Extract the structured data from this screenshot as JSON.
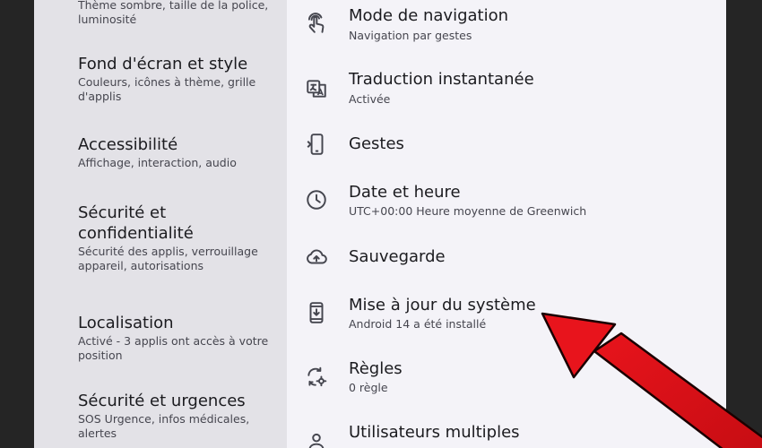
{
  "left_menu": [
    {
      "key": "display",
      "subtitle": "Thème sombre, taille de la police, luminosité"
    },
    {
      "key": "wallpaper",
      "title": "Fond d'écran et style",
      "subtitle": "Couleurs, icônes à thème, grille d'applis"
    },
    {
      "key": "accessibility",
      "title": "Accessibilité",
      "subtitle": "Affichage, interaction, audio"
    },
    {
      "key": "security",
      "title": "Sécurité et confidentialité",
      "subtitle": "Sécurité des applis, verrouillage appareil, autorisations"
    },
    {
      "key": "location",
      "title": "Localisation",
      "subtitle": "Activé - 3 applis ont accès à votre position"
    },
    {
      "key": "emergency",
      "title": "Sécurité et urgences",
      "subtitle": "SOS Urgence, infos médicales, alertes"
    }
  ],
  "system_menu": [
    {
      "key": "navigation-mode",
      "icon": "gesture-hand-icon",
      "title": "Mode de navigation",
      "subtitle": "Navigation par gestes"
    },
    {
      "key": "instant-translation",
      "icon": "translate-icon",
      "title": "Traduction instantanée",
      "subtitle": "Activée"
    },
    {
      "key": "gestures",
      "icon": "phone-gesture-icon",
      "title": "Gestes",
      "subtitle": ""
    },
    {
      "key": "date-time",
      "icon": "clock-icon",
      "title": "Date et heure",
      "subtitle": "UTC+00:00 Heure moyenne de Greenwich"
    },
    {
      "key": "backup",
      "icon": "cloud-upload-icon",
      "title": "Sauvegarde",
      "subtitle": ""
    },
    {
      "key": "system-update",
      "icon": "system-update-icon",
      "title": "Mise à jour du système",
      "subtitle": "Android 14 a été installé"
    },
    {
      "key": "rules",
      "icon": "rules-icon",
      "title": "Règles",
      "subtitle": "0 règle"
    },
    {
      "key": "multiple-users",
      "icon": "person-icon",
      "title": "Utilisateurs multiples",
      "subtitle": ""
    }
  ],
  "annotation": {
    "arrow_color": "#e8141c",
    "target": "system-update"
  },
  "colors": {
    "left_pane_bg": "#e3e2e7",
    "right_pane_bg": "#f4f3f8",
    "text_primary": "#1b1b1f",
    "text_secondary": "#46464f"
  }
}
